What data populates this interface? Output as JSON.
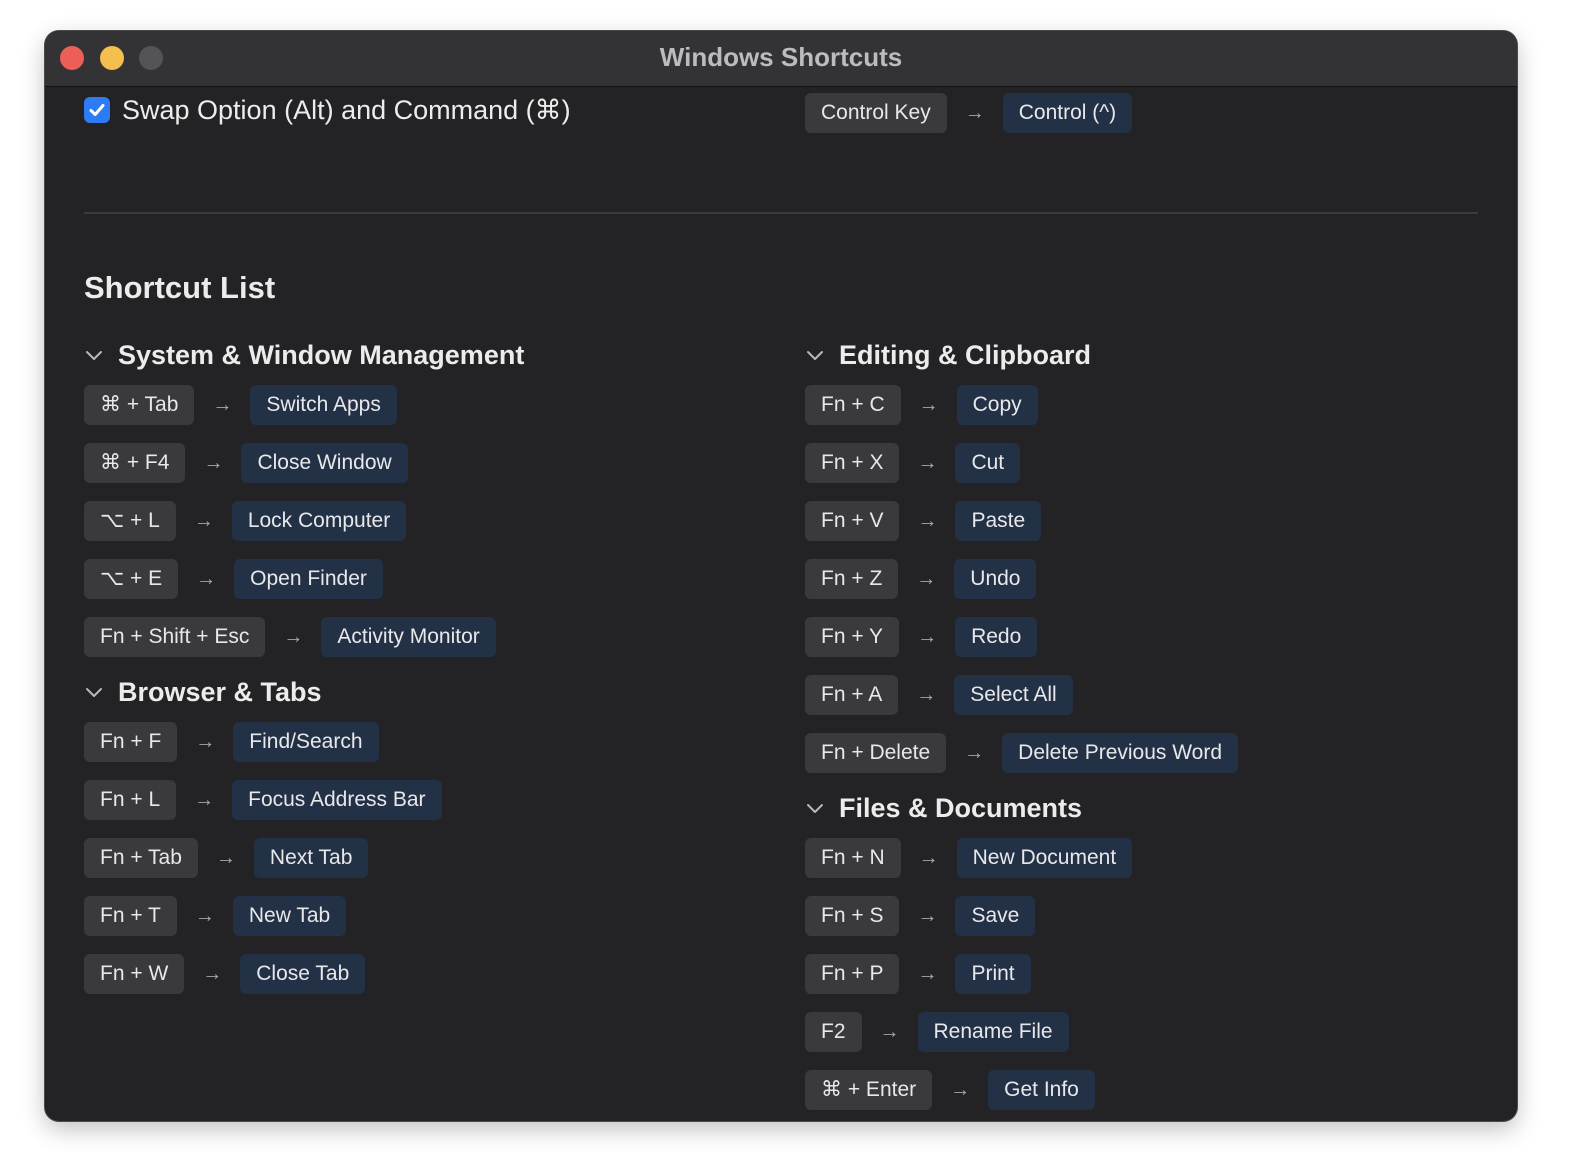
{
  "window": {
    "title": "Windows Shortcuts"
  },
  "swap_option": {
    "checked": true,
    "label": "Swap Option (Alt) and Command (⌘)"
  },
  "control_mapping": {
    "from": "Control Key",
    "to": "Control (^)"
  },
  "shortcut_list": {
    "title": "Shortcut List",
    "columns": [
      [
        {
          "title": "System & Window Management",
          "items": [
            {
              "keys": "⌘ + Tab",
              "action": "Switch Apps"
            },
            {
              "keys": "⌘ + F4",
              "action": "Close Window"
            },
            {
              "keys": "⌥ + L",
              "action": "Lock Computer"
            },
            {
              "keys": "⌥ + E",
              "action": "Open Finder"
            },
            {
              "keys": "Fn + Shift + Esc",
              "action": "Activity Monitor"
            }
          ]
        },
        {
          "title": "Browser & Tabs",
          "items": [
            {
              "keys": "Fn + F",
              "action": "Find/Search"
            },
            {
              "keys": "Fn + L",
              "action": "Focus Address Bar"
            },
            {
              "keys": "Fn + Tab",
              "action": "Next Tab"
            },
            {
              "keys": "Fn + T",
              "action": "New Tab"
            },
            {
              "keys": "Fn + W",
              "action": "Close Tab"
            }
          ]
        }
      ],
      [
        {
          "title": "Editing & Clipboard",
          "items": [
            {
              "keys": "Fn + C",
              "action": "Copy"
            },
            {
              "keys": "Fn + X",
              "action": "Cut"
            },
            {
              "keys": "Fn + V",
              "action": "Paste"
            },
            {
              "keys": "Fn + Z",
              "action": "Undo"
            },
            {
              "keys": "Fn + Y",
              "action": "Redo"
            },
            {
              "keys": "Fn + A",
              "action": "Select All"
            },
            {
              "keys": "Fn + Delete",
              "action": "Delete Previous Word"
            }
          ]
        },
        {
          "title": "Files & Documents",
          "items": [
            {
              "keys": "Fn + N",
              "action": "New Document"
            },
            {
              "keys": "Fn + S",
              "action": "Save"
            },
            {
              "keys": "Fn + P",
              "action": "Print"
            },
            {
              "keys": "F2",
              "action": "Rename File"
            },
            {
              "keys": "⌘ + Enter",
              "action": "Get Info"
            }
          ]
        }
      ]
    ]
  },
  "icons": {
    "checkbox": "checkmark-icon",
    "section_toggle": "chevron-down-icon",
    "mapping": "arrow-right-icon"
  },
  "colors": {
    "window_bg": "#232325",
    "titlebar_bg": "#333335",
    "key_bg": "#3a3a3d",
    "action_bg": "#233146",
    "checkbox_accent": "#2e7bf6",
    "close_button": "#ec5f57",
    "minimize_button": "#f4bf4f",
    "zoom_button": "#545456"
  }
}
